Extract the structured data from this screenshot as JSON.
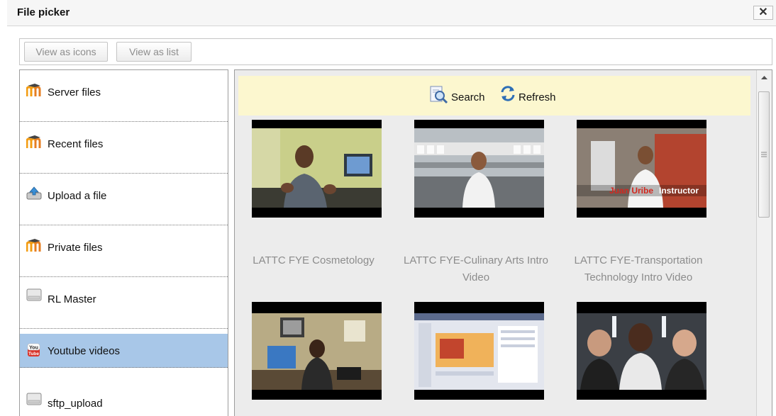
{
  "dialog": {
    "title": "File picker",
    "close_glyph": "✕"
  },
  "toolbar": {
    "view_icons_label": "View as icons",
    "view_list_label": "View as list"
  },
  "sidebar": {
    "items": [
      {
        "label": "Server files",
        "icon": "moodle-icon"
      },
      {
        "label": "Recent files",
        "icon": "moodle-icon"
      },
      {
        "label": "Upload a file",
        "icon": "upload-icon"
      },
      {
        "label": "Private files",
        "icon": "moodle-icon"
      },
      {
        "label": "RL Master",
        "icon": "drive-icon"
      },
      {
        "label": "Youtube videos",
        "icon": "youtube-icon",
        "selected": true
      },
      {
        "label": "sftp_upload",
        "icon": "drive-icon"
      }
    ]
  },
  "actions": {
    "search_label": "Search",
    "refresh_label": "Refresh"
  },
  "videos": [
    {
      "caption": "LATTC FYE Cosmetology"
    },
    {
      "caption": "LATTC FYE-Culinary Arts Intro Video"
    },
    {
      "caption": "LATTC FYE-Transportation Technology Intro Video",
      "overlay_name": "Juan Uribe",
      "overlay_role": "Instructor"
    },
    {
      "caption": ""
    },
    {
      "caption": ""
    },
    {
      "caption": ""
    }
  ],
  "colors": {
    "selected_bg": "#a8c7e8",
    "actionbar_bg": "#fcf7cf",
    "content_bg": "#ececec"
  }
}
